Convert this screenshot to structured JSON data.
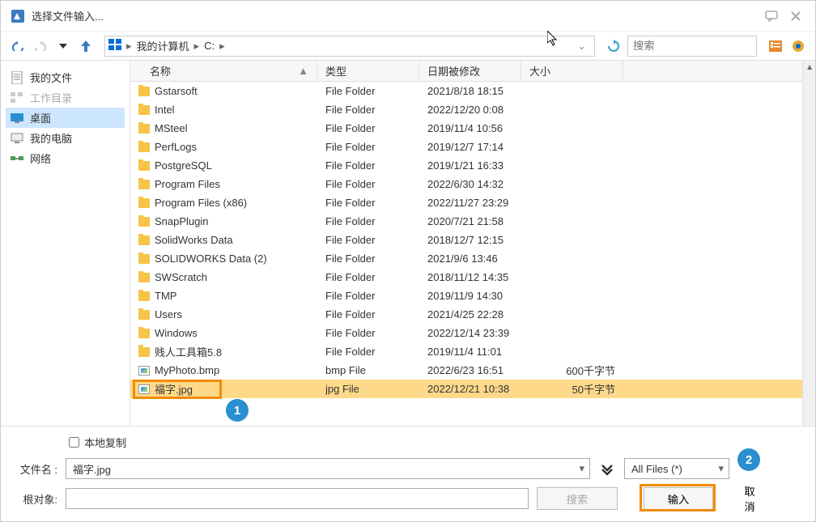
{
  "title": "选择文件输入...",
  "breadcrumb": {
    "root": "我的计算机",
    "drive": "C:"
  },
  "search_placeholder": "搜索",
  "sidebar": {
    "myfiles": "我的文件",
    "workdir": "工作目录",
    "desktop": "桌面",
    "mypc": "我的电脑",
    "network": "网络"
  },
  "columns": {
    "name": "名称",
    "type": "类型",
    "date": "日期被修改",
    "size": "大小"
  },
  "rows": [
    {
      "name": "Gstarsoft",
      "type": "File Folder",
      "date": "2021/8/18 18:15",
      "size": "",
      "icon": "folder"
    },
    {
      "name": "Intel",
      "type": "File Folder",
      "date": "2022/12/20 0:08",
      "size": "",
      "icon": "folder"
    },
    {
      "name": "MSteel",
      "type": "File Folder",
      "date": "2019/11/4 10:56",
      "size": "",
      "icon": "folder"
    },
    {
      "name": "PerfLogs",
      "type": "File Folder",
      "date": "2019/12/7 17:14",
      "size": "",
      "icon": "folder"
    },
    {
      "name": "PostgreSQL",
      "type": "File Folder",
      "date": "2019/1/21 16:33",
      "size": "",
      "icon": "folder"
    },
    {
      "name": "Program Files",
      "type": "File Folder",
      "date": "2022/6/30 14:32",
      "size": "",
      "icon": "folder"
    },
    {
      "name": "Program Files (x86)",
      "type": "File Folder",
      "date": "2022/11/27 23:29",
      "size": "",
      "icon": "folder"
    },
    {
      "name": "SnapPlugin",
      "type": "File Folder",
      "date": "2020/7/21 21:58",
      "size": "",
      "icon": "folder"
    },
    {
      "name": "SolidWorks Data",
      "type": "File Folder",
      "date": "2018/12/7 12:15",
      "size": "",
      "icon": "folder"
    },
    {
      "name": "SOLIDWORKS Data (2)",
      "type": "File Folder",
      "date": "2021/9/6 13:46",
      "size": "",
      "icon": "folder"
    },
    {
      "name": "SWScratch",
      "type": "File Folder",
      "date": "2018/11/12 14:35",
      "size": "",
      "icon": "folder"
    },
    {
      "name": "TMP",
      "type": "File Folder",
      "date": "2019/11/9 14:30",
      "size": "",
      "icon": "folder"
    },
    {
      "name": "Users",
      "type": "File Folder",
      "date": "2021/4/25 22:28",
      "size": "",
      "icon": "folder"
    },
    {
      "name": "Windows",
      "type": "File Folder",
      "date": "2022/12/14 23:39",
      "size": "",
      "icon": "folder"
    },
    {
      "name": "贱人工具箱5.8",
      "type": "File Folder",
      "date": "2019/11/4 11:01",
      "size": "",
      "icon": "folder"
    },
    {
      "name": "MyPhoto.bmp",
      "type": "bmp File",
      "date": "2022/6/23 16:51",
      "size": "600千字节",
      "icon": "img"
    },
    {
      "name": "福字.jpg",
      "type": "jpg File",
      "date": "2022/12/21 10:38",
      "size": "50千字节",
      "icon": "img",
      "selected": true
    }
  ],
  "local_copy": "本地复制",
  "filename_label": "文件名 :",
  "filename_value": "福字.jpg",
  "root_label": "根对象:",
  "search_btn": "搜索",
  "filter": "All Files (*)",
  "open_btn": "输入",
  "cancel_btn": "取消",
  "annot": {
    "one": "1",
    "two": "2"
  }
}
